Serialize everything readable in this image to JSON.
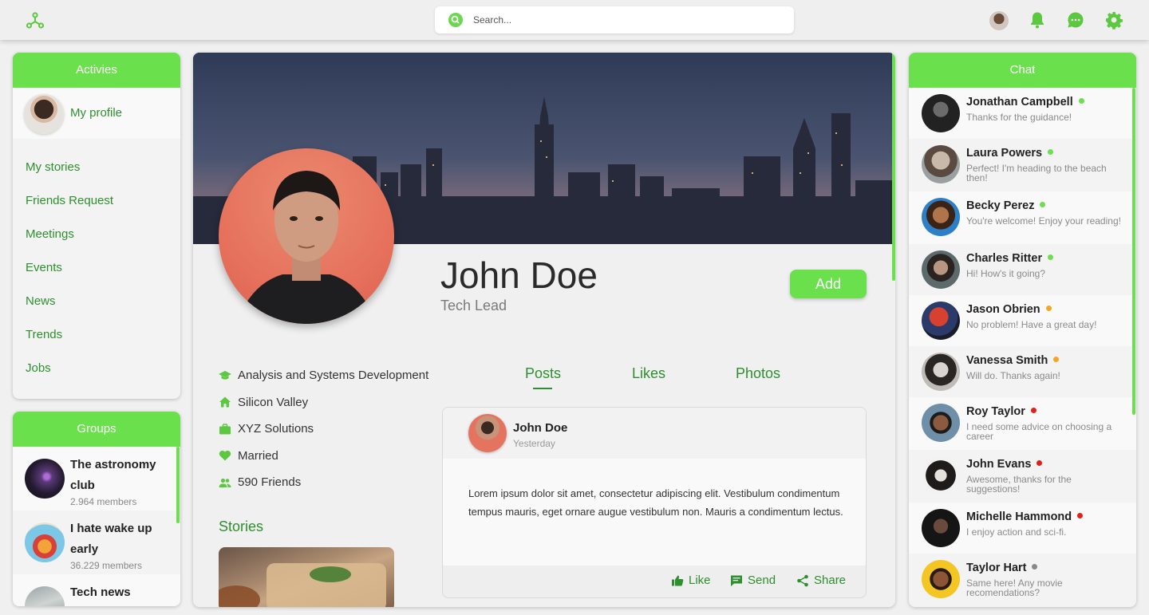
{
  "colors": {
    "accent": "#6be04d",
    "link": "#2e8f2e",
    "online": "#6be04d",
    "away": "#f5a623",
    "busy": "#e0201a",
    "offline": "#888888"
  },
  "topbar": {
    "search": {
      "placeholder": "Search..."
    },
    "icons": [
      "logo-icon",
      "search-icon",
      "avatar",
      "bell-icon",
      "chat-bubble-icon",
      "gear-icon"
    ]
  },
  "activities": {
    "title": "Activies",
    "profile_label": "My profile",
    "items": [
      "My stories",
      "Friends Request",
      "Meetings",
      "Events",
      "News",
      "Trends",
      "Jobs"
    ]
  },
  "groups": {
    "title": "Groups",
    "items": [
      {
        "name": "The astronomy club",
        "members": "2.964 members"
      },
      {
        "name": "I hate wake up early",
        "members": "36.229 members"
      },
      {
        "name": "Tech news",
        "members": ""
      }
    ]
  },
  "profile": {
    "name": "John Doe",
    "role": "Tech Lead",
    "add_label": "Add",
    "info": [
      {
        "icon": "graduation-cap-icon",
        "text": "Analysis and Systems Development"
      },
      {
        "icon": "home-icon",
        "text": "Silicon Valley"
      },
      {
        "icon": "briefcase-icon",
        "text": "XYZ Solutions"
      },
      {
        "icon": "heart-icon",
        "text": "Married"
      },
      {
        "icon": "users-icon",
        "text": "590 Friends"
      }
    ],
    "stories_title": "Stories",
    "tabs": [
      "Posts",
      "Likes",
      "Photos"
    ],
    "active_tab": "Posts"
  },
  "post": {
    "author": "John Doe",
    "time": "Yesterday",
    "body": "Lorem ipsum dolor sit amet, consectetur adipiscing elit. Vestibulum condimentum tempus mauris, eget ornare augue vestibulum non. Mauris a condimentum lectus.",
    "actions": [
      "Like",
      "Send",
      "Share"
    ]
  },
  "chat": {
    "title": "Chat",
    "contacts": [
      {
        "name": "Jonathan Campbell",
        "message": "Thanks for the guidance!",
        "status": "online"
      },
      {
        "name": "Laura Powers",
        "message": "Perfect! I'm heading to the beach then!",
        "status": "online"
      },
      {
        "name": "Becky Perez",
        "message": "You're welcome! Enjoy your reading!",
        "status": "online"
      },
      {
        "name": "Charles Ritter",
        "message": "Hi! How's it going?",
        "status": "online"
      },
      {
        "name": "Jason Obrien",
        "message": "No problem! Have a great day!",
        "status": "away"
      },
      {
        "name": "Vanessa Smith",
        "message": "Will do. Thanks again!",
        "status": "away"
      },
      {
        "name": "Roy Taylor",
        "message": "I need some advice on choosing a career",
        "status": "busy"
      },
      {
        "name": "John Evans",
        "message": "Awesome, thanks for the suggestions!",
        "status": "busy"
      },
      {
        "name": "Michelle Hammond",
        "message": "I enjoy action and sci-fi.",
        "status": "busy"
      },
      {
        "name": "Taylor Hart",
        "message": "Same here! Any movie recomendations?",
        "status": "offline"
      }
    ]
  }
}
